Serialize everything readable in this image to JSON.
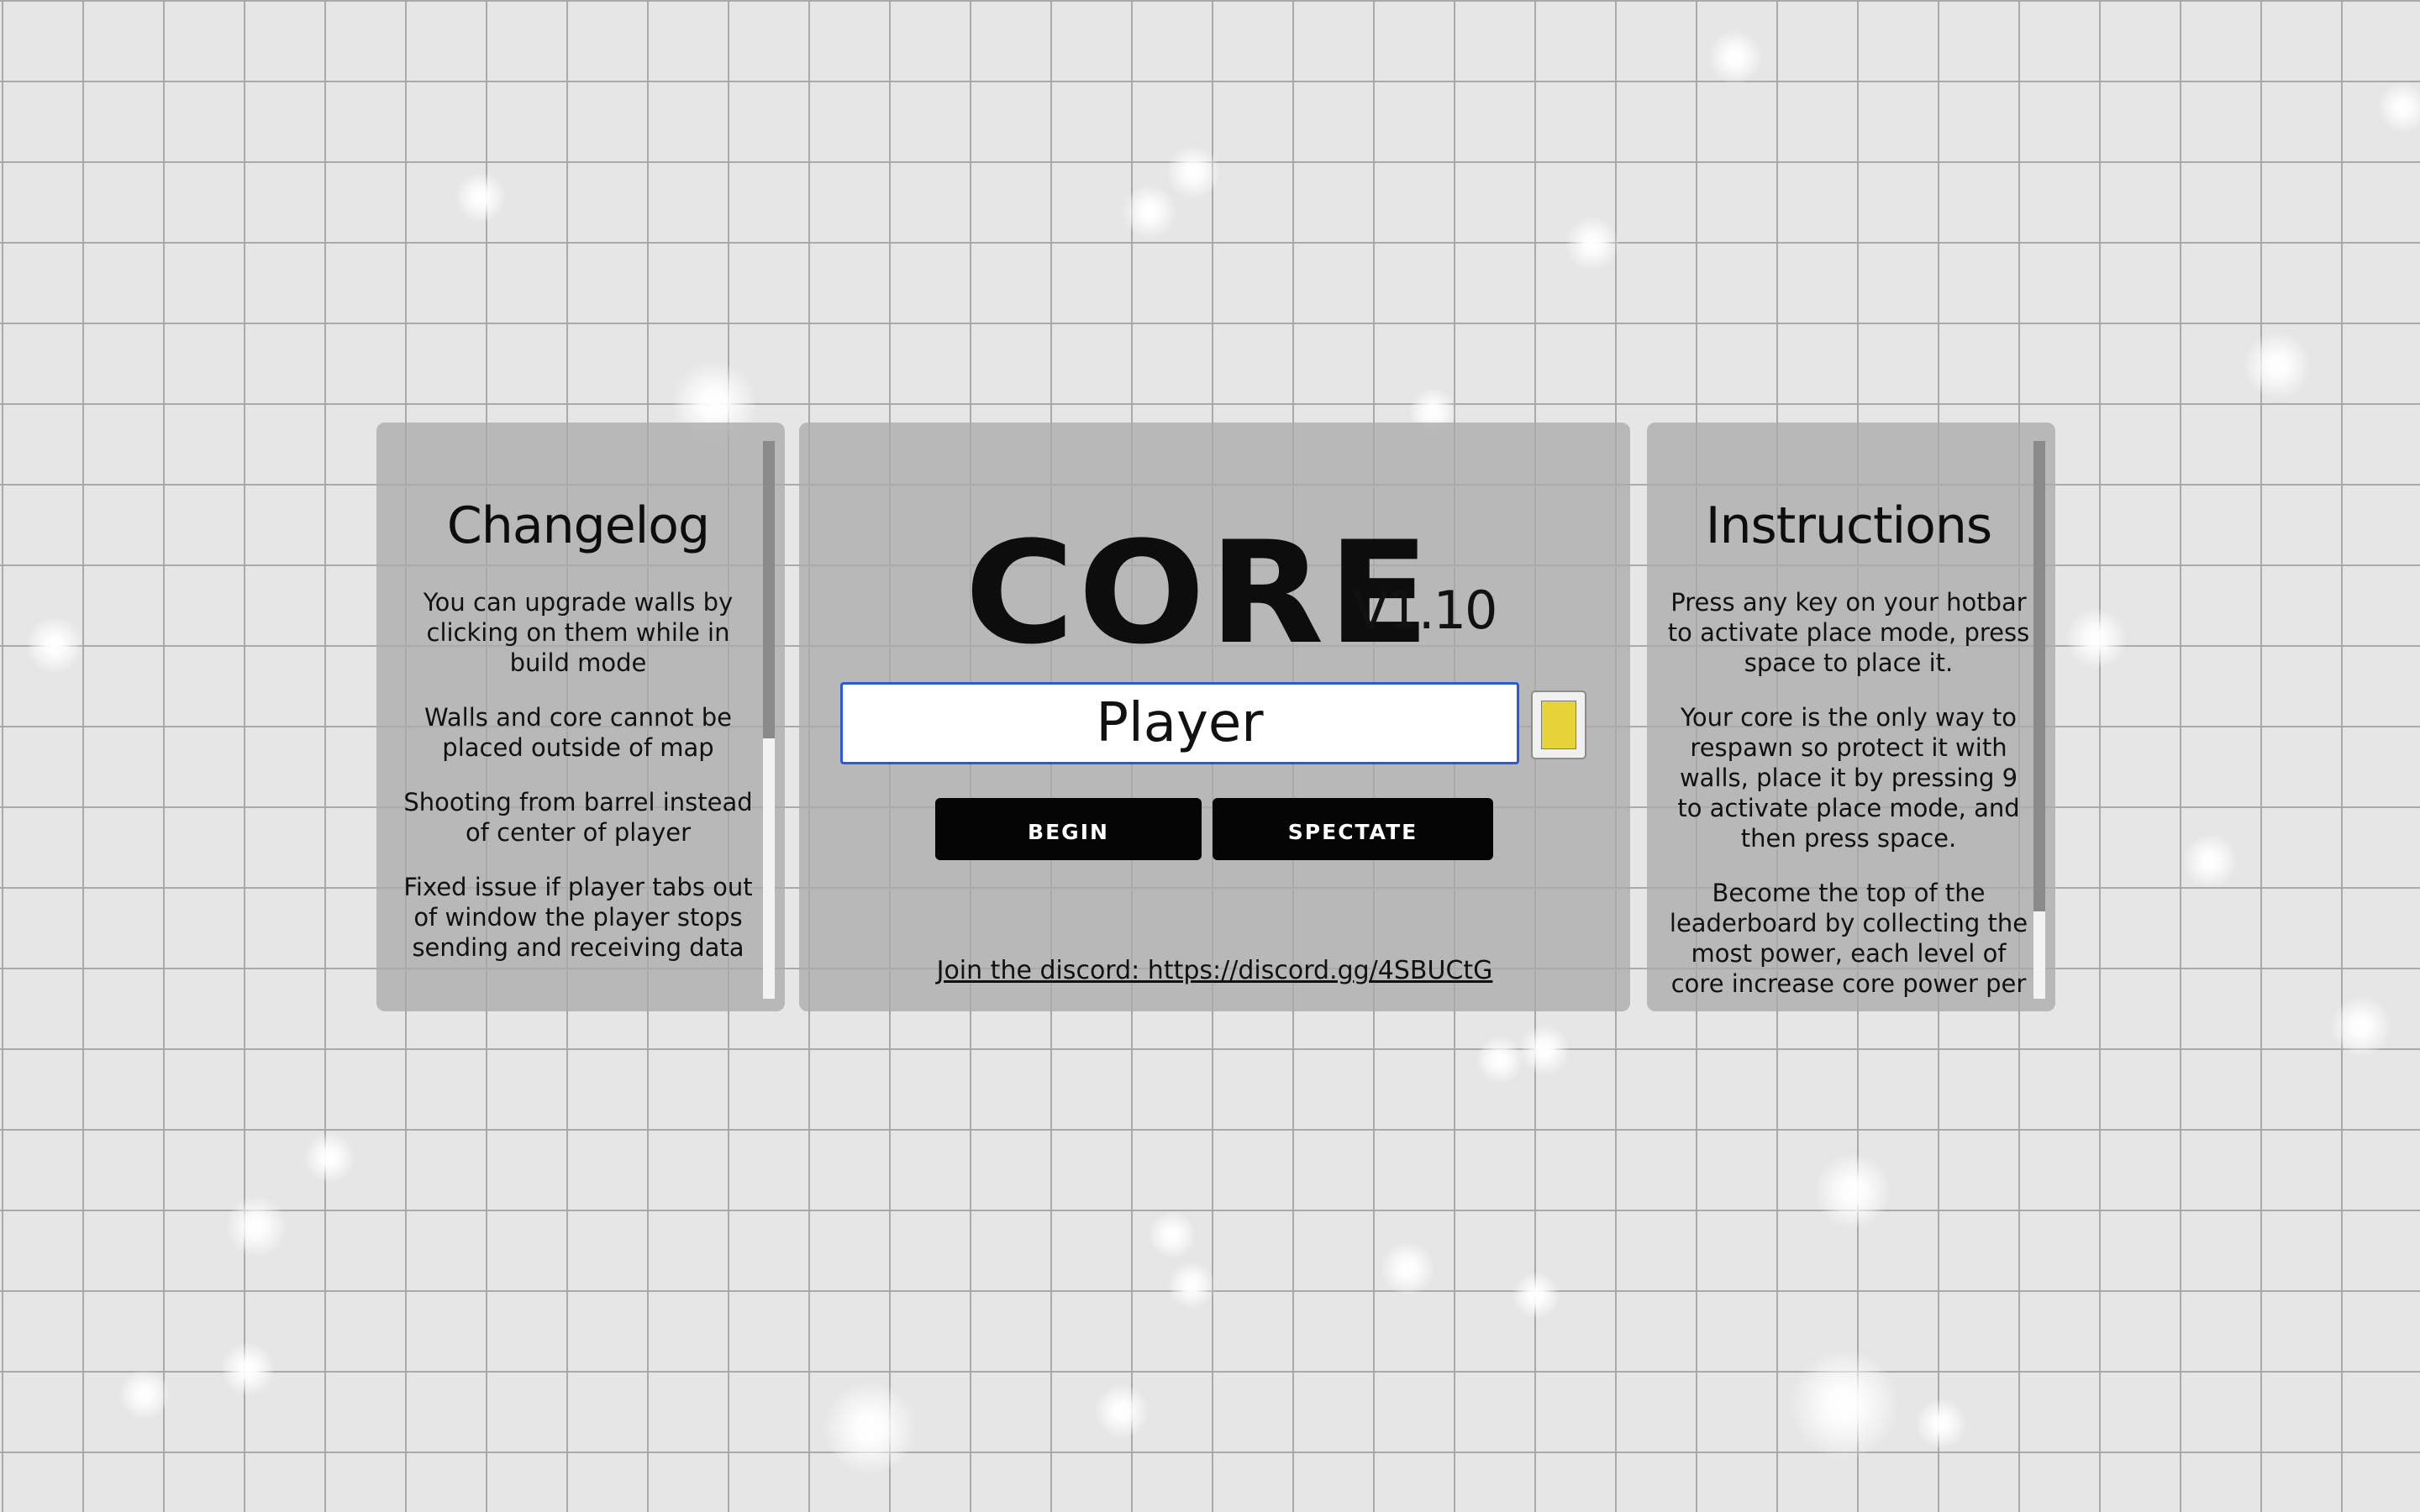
{
  "game": {
    "title": "CORE",
    "version": "V1.10"
  },
  "changelog": {
    "title": "Changelog",
    "items": [
      "You can upgrade walls by clicking on them while in build mode",
      "Walls and core cannot be placed outside of map",
      "Shooting from barrel instead of center of player",
      "Fixed issue if player tabs out of window the player stops sending and receiving data"
    ]
  },
  "instructions": {
    "title": "Instructions",
    "items": [
      "Press any key on your hotbar to activate place mode, press space to place it.",
      "Your core is the only way to respawn so protect it with walls, place it by pressing 9 to activate place mode, and then press space.",
      "Become the top of the leaderboard by collecting the most power, each level of core increase core power per"
    ]
  },
  "form": {
    "name_value": "Player",
    "player_color": "#e6d33a",
    "begin_label": "Begin",
    "spectate_label": "Spectate"
  },
  "footer": {
    "discord_text": "Join the discord: https://discord.gg/4SBUCtG"
  },
  "colors": {
    "background": "#e6e6e6",
    "grid": "#a9a9a9",
    "panel": "#aaaaaa",
    "button": "#050505",
    "input_border": "#2a5bd7"
  }
}
